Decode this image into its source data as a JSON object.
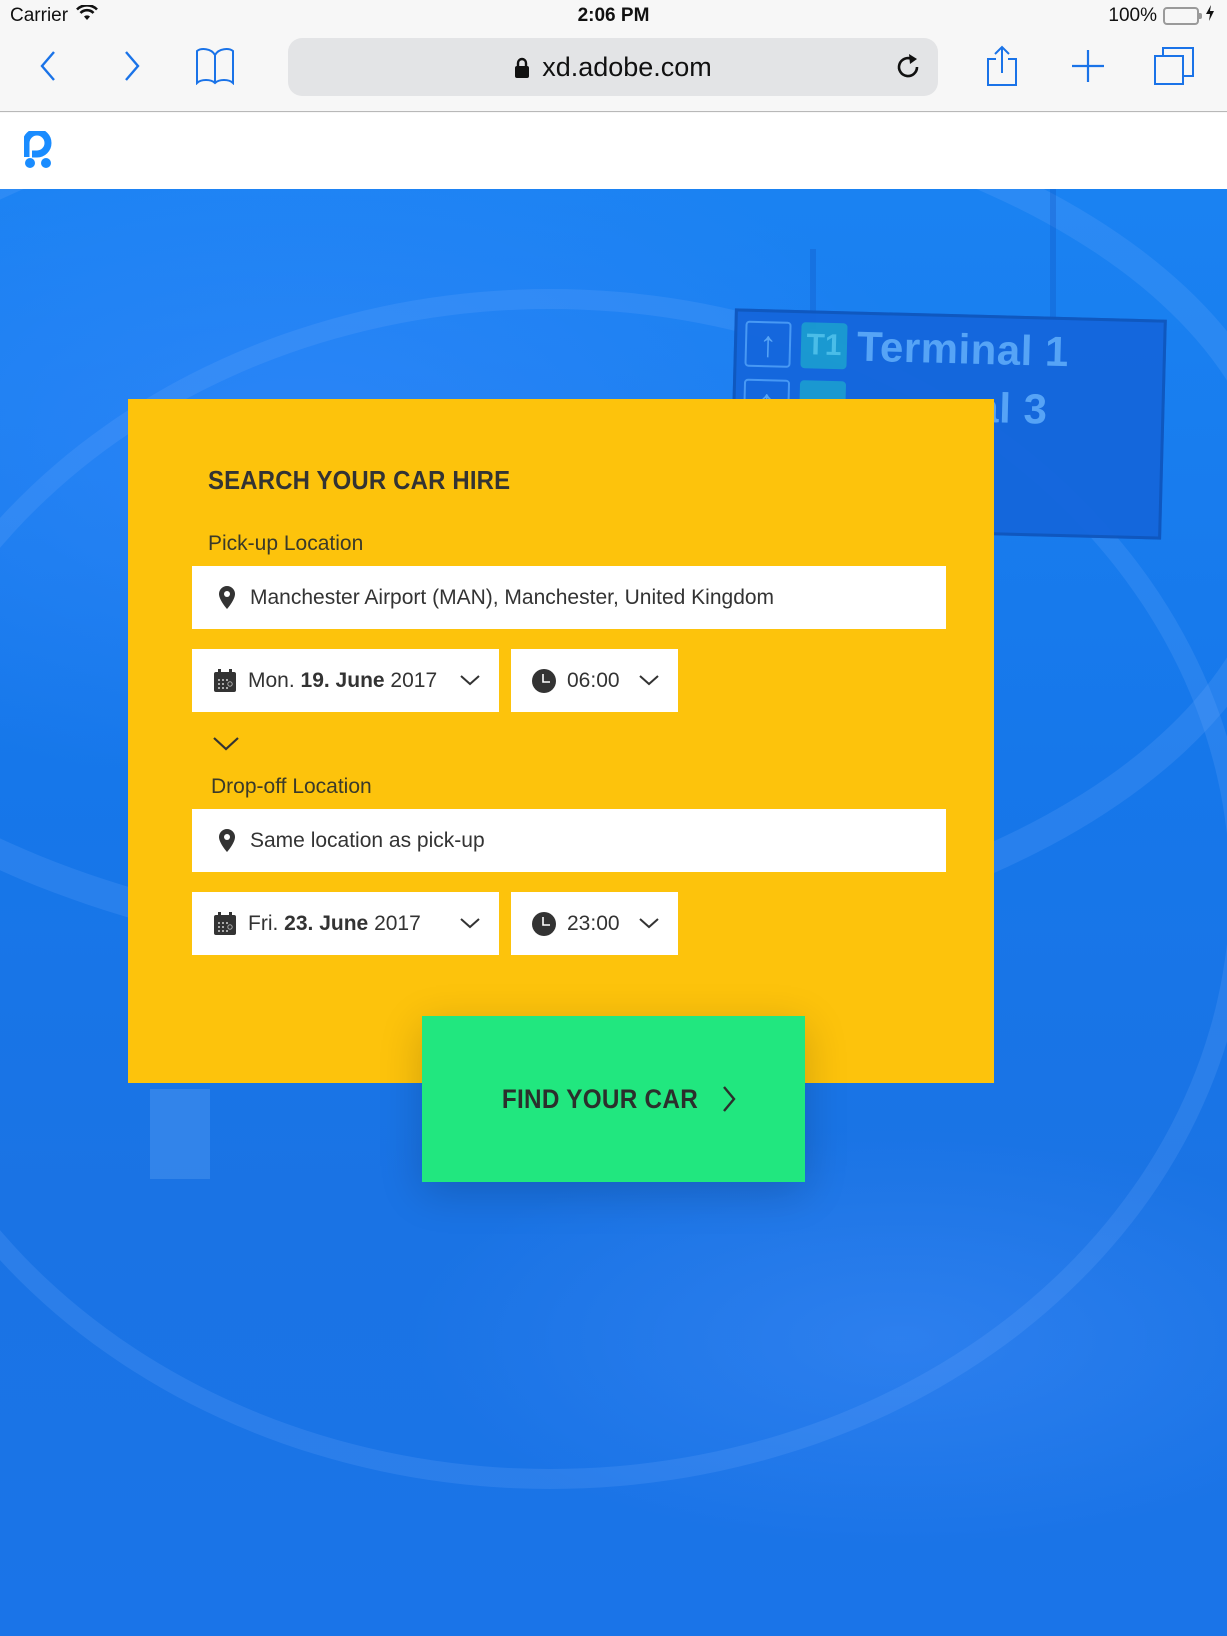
{
  "status_bar": {
    "carrier": "Carrier",
    "time": "2:06 PM",
    "battery_percent_label": "100%",
    "battery_level": 1.0
  },
  "browser": {
    "url": "xd.adobe.com",
    "icons": {
      "back": "chevron-left-icon",
      "forward": "chevron-right-icon",
      "bookmarks": "book-icon",
      "lock": "lock-icon",
      "reload": "reload-icon",
      "share": "share-icon",
      "new_tab": "plus-icon",
      "tabs": "tabs-icon"
    },
    "accent_color": "#1a73e8"
  },
  "site": {
    "logo": "brand-logo",
    "brand_color": "#1a8cff"
  },
  "background": {
    "sign_lines": [
      {
        "badge": "T1",
        "text": "Terminal 1"
      },
      {
        "badge": "",
        "text": "al 3"
      }
    ]
  },
  "search_form": {
    "title": "SEARCH YOUR CAR HIRE",
    "pickup": {
      "label": "Pick-up Location",
      "location": "Manchester Airport (MAN), Manchester, United Kingdom",
      "date_day": "Mon.",
      "date_main": "19. June",
      "date_year": "2017",
      "time": "06:00"
    },
    "dropoff": {
      "label": "Drop-off Location",
      "location": "Same location as pick-up",
      "date_day": "Fri.",
      "date_main": "23. June",
      "date_year": "2017",
      "time": "23:00"
    },
    "card_color": "#fdc30c",
    "submit": {
      "label": "FIND YOUR CAR",
      "color": "#21e77f"
    }
  }
}
